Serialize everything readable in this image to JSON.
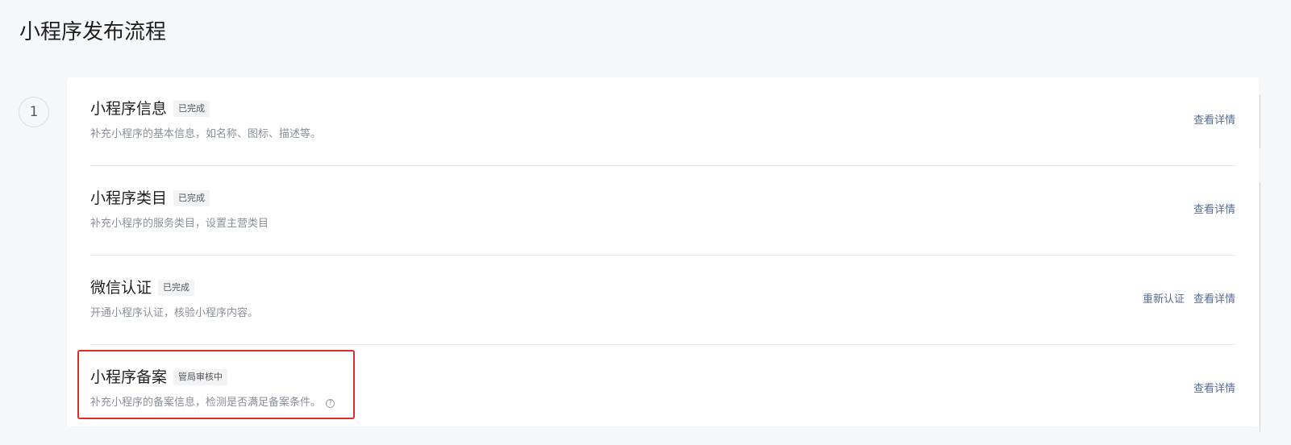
{
  "page": {
    "title": "小程序发布流程",
    "step_number": "1"
  },
  "steps": [
    {
      "title": "小程序信息",
      "badge": "已完成",
      "description": "补充小程序的基本信息，如名称、图标、描述等。",
      "actions": [
        "查看详情"
      ]
    },
    {
      "title": "小程序类目",
      "badge": "已完成",
      "description": "补充小程序的服务类目，设置主营类目",
      "actions": [
        "查看详情"
      ]
    },
    {
      "title": "微信认证",
      "badge": "已完成",
      "description": "开通小程序认证，核验小程序内容。",
      "actions": [
        "重新认证",
        "查看详情"
      ]
    },
    {
      "title": "小程序备案",
      "badge": "管局审核中",
      "description": "补充小程序的备案信息，检测是否满足备案条件。",
      "has_help_icon": true,
      "help_icon": "question-circle-icon",
      "actions": [
        "查看详情"
      ]
    }
  ],
  "colors": {
    "background": "#f6f7f9",
    "link": "#576b95",
    "highlight": "#e02a2a",
    "badge_bg": "#f2f3f5"
  }
}
